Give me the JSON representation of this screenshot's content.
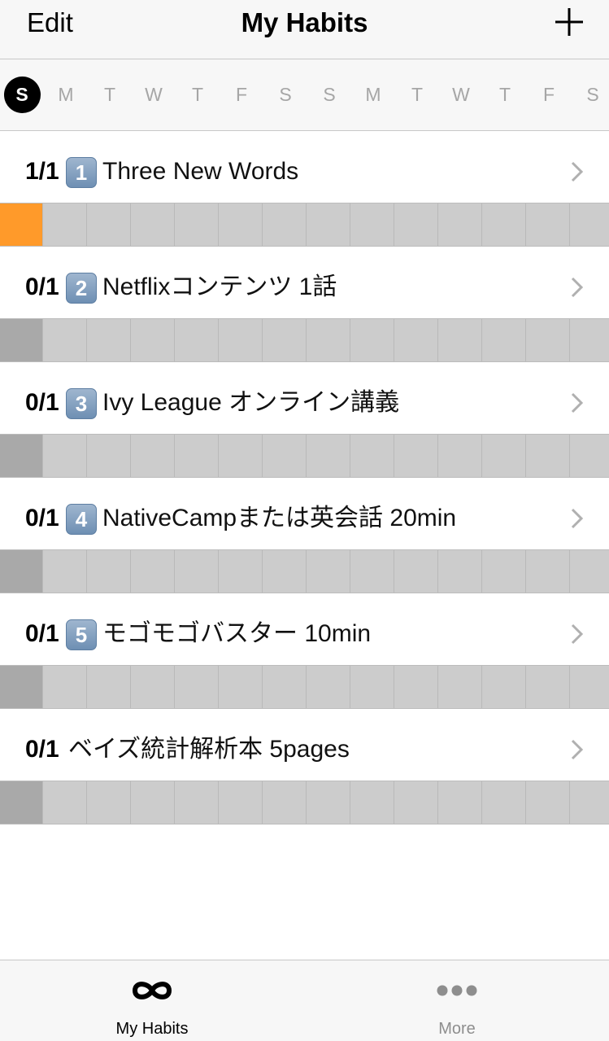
{
  "navbar": {
    "edit_label": "Edit",
    "title": "My Habits",
    "add_icon": "plus-icon"
  },
  "days": [
    "S",
    "M",
    "T",
    "W",
    "T",
    "F",
    "S",
    "S",
    "M",
    "T",
    "W",
    "T",
    "F",
    "S"
  ],
  "current_day_index": 0,
  "habits": [
    {
      "count": "1/1",
      "icon": "1",
      "name": "Three New Words",
      "done_days": [
        0
      ]
    },
    {
      "count": "0/1",
      "icon": "2",
      "name": "Netflixコンテンツ 1話",
      "done_days": []
    },
    {
      "count": "0/1",
      "icon": "3",
      "name": "Ivy League オンライン講義",
      "done_days": []
    },
    {
      "count": "0/1",
      "icon": "4",
      "name": "NativeCampまたは英会話 20min",
      "done_days": []
    },
    {
      "count": "0/1",
      "icon": "5",
      "name": "モゴモゴバスター 10min",
      "done_days": []
    },
    {
      "count": "0/1",
      "icon": "",
      "name": "ベイズ統計解析本 5pages",
      "done_days": []
    }
  ],
  "colors": {
    "done": "#ff9a2a",
    "today_empty": "#a9a9a9",
    "empty": "#cccccc",
    "inactive_tab": "#8e8e8e"
  },
  "tabbar": {
    "items": [
      {
        "label": "My Habits",
        "icon": "infinity-icon",
        "active": true
      },
      {
        "label": "More",
        "icon": "more-dots-icon",
        "active": false
      }
    ]
  }
}
